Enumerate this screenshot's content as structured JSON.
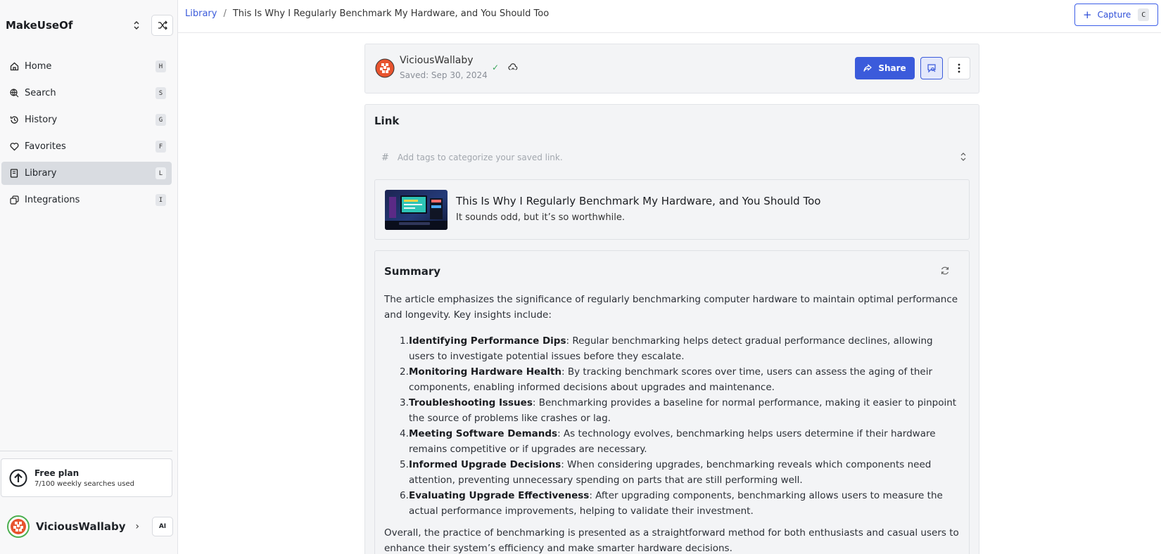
{
  "sidebar": {
    "workspace": "MakeUseOf",
    "items": [
      {
        "label": "Home",
        "shortcut": "H",
        "icon": "home-icon"
      },
      {
        "label": "Search",
        "shortcut": "S",
        "icon": "search-globe-icon"
      },
      {
        "label": "History",
        "shortcut": "G",
        "icon": "history-icon"
      },
      {
        "label": "Favorites",
        "shortcut": "F",
        "icon": "heart-icon"
      },
      {
        "label": "Library",
        "shortcut": "L",
        "icon": "book-icon",
        "active": true
      },
      {
        "label": "Integrations",
        "shortcut": "I",
        "icon": "integrations-icon"
      }
    ],
    "plan": {
      "title": "Free plan",
      "usage": "7/100 weekly searches used"
    },
    "user": {
      "name": "ViciousWallaby",
      "ai_label": "AI"
    }
  },
  "topbar": {
    "breadcrumb_root": "Library",
    "breadcrumb_sep": "/",
    "breadcrumb_current": "This Is Why I Regularly Benchmark My Hardware, and You Should Too",
    "capture_label": "Capture",
    "capture_shortcut": "C"
  },
  "header": {
    "username": "ViciousWallaby",
    "saved": "Saved: Sep 30, 2024",
    "share_label": "Share"
  },
  "link": {
    "section_title": "Link",
    "tags_hash": "#",
    "tags_placeholder": "Add tags to categorize your saved link.",
    "preview_title": "This Is Why I Regularly Benchmark My Hardware, and You Should Too",
    "preview_subtitle": "It sounds odd, but it’s so worthwhile."
  },
  "summary": {
    "title": "Summary",
    "intro": "The article emphasizes the significance of regularly benchmarking computer hardware to maintain optimal performance and longevity. Key insights include:",
    "points": [
      {
        "num": "1.",
        "key": "Identifying Performance Dips",
        "text": ": Regular benchmarking helps detect gradual performance declines, allowing users to investigate potential issues before they escalate."
      },
      {
        "num": "2.",
        "key": "Monitoring Hardware Health",
        "text": ": By tracking benchmark scores over time, users can assess the aging of their components, enabling informed decisions about upgrades and maintenance."
      },
      {
        "num": "3.",
        "key": "Troubleshooting Issues",
        "text": ": Benchmarking provides a baseline for normal performance, making it easier to pinpoint the source of problems like crashes or lag."
      },
      {
        "num": "4.",
        "key": "Meeting Software Demands",
        "text": ": As technology evolves, benchmarking helps users determine if their hardware remains competitive or if upgrades are necessary."
      },
      {
        "num": "5.",
        "key": "Informed Upgrade Decisions",
        "text": ": When considering upgrades, benchmarking reveals which components need attention, preventing unnecessary spending on parts that are still performing well."
      },
      {
        "num": "6.",
        "key": "Evaluating Upgrade Effectiveness",
        "text": ": After upgrading components, benchmarking allows users to measure the actual performance improvements, helping to validate their investment."
      }
    ],
    "outro": "Overall, the practice of benchmarking is presented as a straightforward method for both enthusiasts and casual users to enhance their system’s efficiency and make smarter hardware decisions."
  },
  "colors": {
    "accent": "#3b5bdb",
    "active_nav": "#d9dce1",
    "success": "#3ba55c"
  }
}
